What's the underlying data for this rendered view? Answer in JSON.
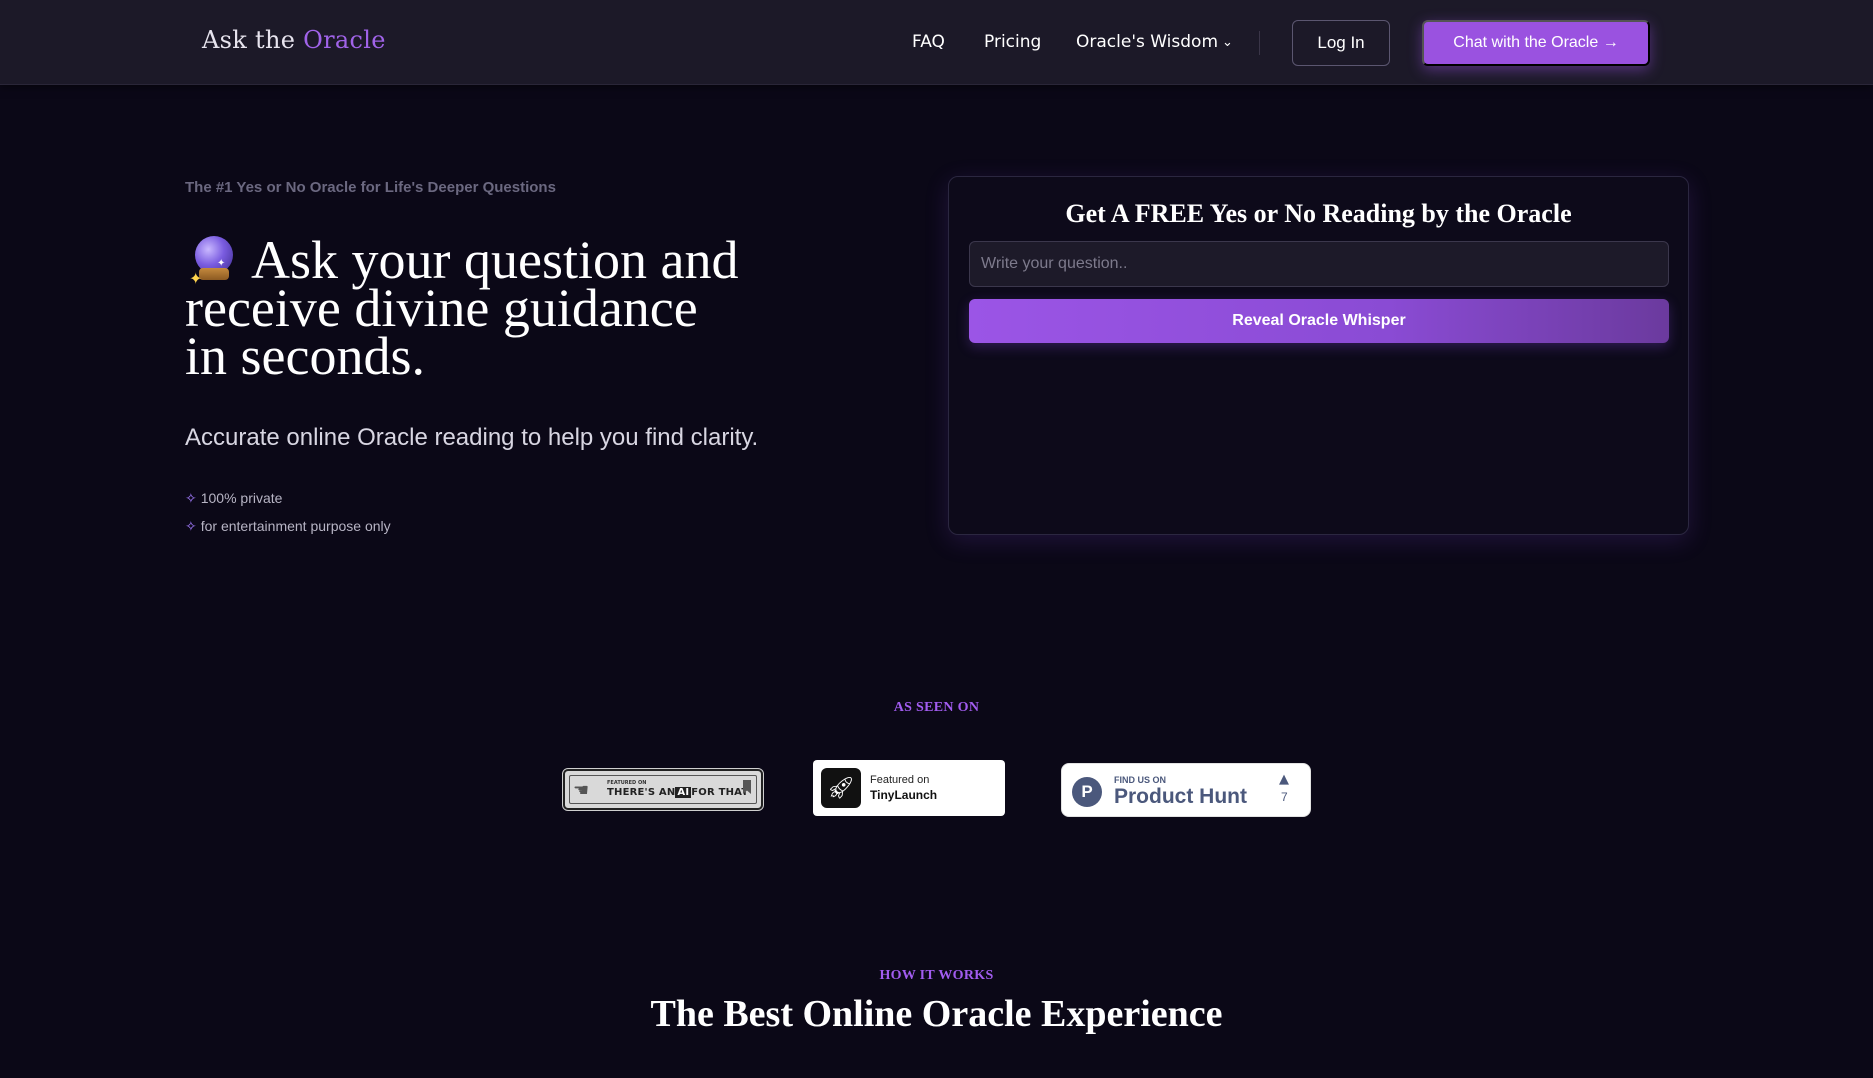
{
  "nav": {
    "logo_prefix": "Ask the",
    "logo_accent": "Oracle",
    "links": [
      "FAQ",
      "Pricing",
      "Oracle's Wisdom"
    ],
    "login_label": "Log In",
    "cta_label": "Chat with the Oracle →"
  },
  "hero": {
    "tagline": "The #1 Yes or No Oracle for Life's Deeper Questions",
    "title_line1": "Ask your question and",
    "title_line2": "receive divine guidance",
    "title_line3": "in seconds.",
    "subtitle": "Accurate online Oracle reading to help you find clarity.",
    "bullets": [
      "100% private",
      "for entertainment purpose only"
    ],
    "bullet_symbol": "✧"
  },
  "reading_card": {
    "title": "Get A FREE Yes or No Reading by the Oracle",
    "input_placeholder": "Write your question..",
    "input_value": "",
    "button_label": "Reveal Oracle Whisper"
  },
  "as_seen_on": {
    "label": "AS SEEN ON",
    "badges": {
      "aift": {
        "small": "FEATURED ON",
        "line_prefix": "THERE'S AN",
        "line_ai": "AI",
        "line_suffix": "FOR THAT"
      },
      "tinylaunch": {
        "line1": "Featured on",
        "line2": "TinyLaunch"
      },
      "producthunt": {
        "line1": "FIND US ON",
        "line2": "Product Hunt",
        "upvotes": "7"
      }
    }
  },
  "how_it_works": {
    "label": "HOW IT WORKS",
    "title": "The Best Online Oracle Experience"
  },
  "colors": {
    "background": "#0b0817",
    "nav_background": "#1c1928",
    "accent": "#9a52e0",
    "accent_text": "#a25cf0"
  },
  "icons": {
    "crystal_ball": "crystal-ball-icon",
    "chevron": "chevron-down-icon",
    "rocket": "rocket-icon",
    "producthunt_logo": "producthunt-logo-icon",
    "upvote": "upvote-arrow-icon"
  }
}
